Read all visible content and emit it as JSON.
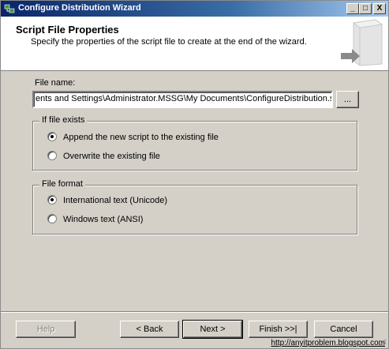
{
  "window": {
    "title": "Configure Distribution Wizard",
    "controls": {
      "minimize": "_",
      "maximize": "□",
      "close": "X"
    }
  },
  "header": {
    "title": "Script File Properties",
    "subtitle": "Specify the properties of the script file to create at the end of the wizard."
  },
  "file_name": {
    "label": "File name:",
    "value": "ents and Settings\\Administrator.MSSG\\My Documents\\ConfigureDistribution.sql",
    "browse_label": "..."
  },
  "if_exists": {
    "legend": "If file exists",
    "options": [
      {
        "label": "Append the new script to the existing file",
        "selected": true
      },
      {
        "label": "Overwrite the existing file",
        "selected": false
      }
    ]
  },
  "file_format": {
    "legend": "File format",
    "options": [
      {
        "label": "International text (Unicode)",
        "selected": true
      },
      {
        "label": "Windows text (ANSI)",
        "selected": false
      }
    ]
  },
  "buttons": {
    "help": "Help",
    "back": "< Back",
    "next": "Next >",
    "finish": "Finish >>|",
    "cancel": "Cancel"
  },
  "watermark": "http://anyitproblem.blogspot.com"
}
